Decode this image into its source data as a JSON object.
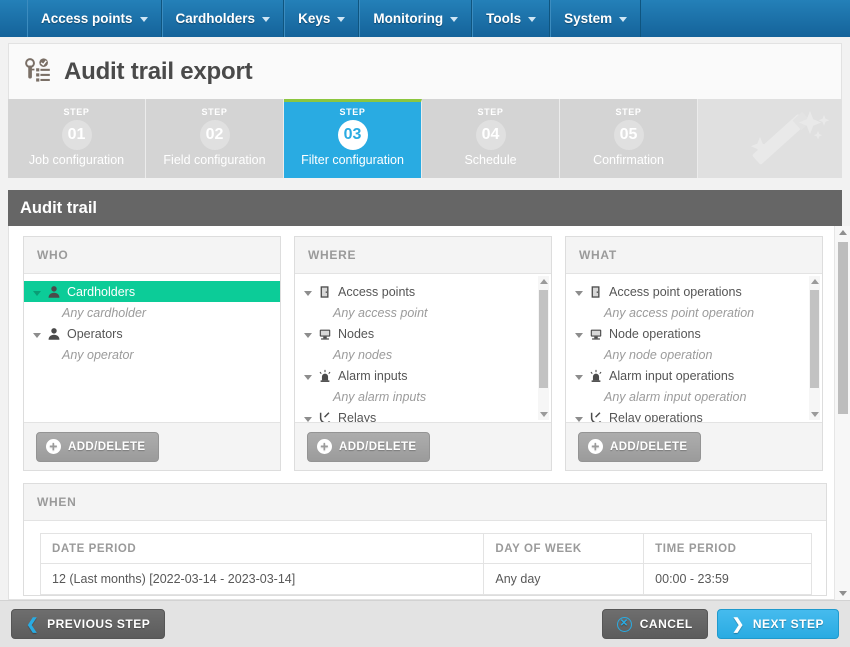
{
  "navbar": {
    "items": [
      {
        "label": "Access points",
        "icon": "chevron-down-icon"
      },
      {
        "label": "Cardholders",
        "icon": "chevron-down-icon"
      },
      {
        "label": "Keys",
        "icon": "chevron-down-icon"
      },
      {
        "label": "Monitoring",
        "icon": "chevron-down-icon"
      },
      {
        "label": "Tools",
        "icon": "chevron-down-icon"
      },
      {
        "label": "System",
        "icon": "chevron-down-icon"
      }
    ]
  },
  "header": {
    "title": "Audit trail export",
    "icon": "key-list-icon"
  },
  "wizard": {
    "step_word": "STEP",
    "watermark_icon": "magic-wand-icon",
    "active_index": 2,
    "active_accent": "#8cc63f",
    "active_bg": "#29abe2",
    "steps": [
      {
        "number": "01",
        "label": "Job configuration"
      },
      {
        "number": "02",
        "label": "Field configuration"
      },
      {
        "number": "03",
        "label": "Filter configuration"
      },
      {
        "number": "04",
        "label": "Schedule"
      },
      {
        "number": "05",
        "label": "Confirmation"
      }
    ]
  },
  "section": {
    "title": "Audit trail"
  },
  "panels": [
    {
      "key": "who",
      "title": "WHO",
      "add_delete_label": "ADD/DELETE",
      "add_icon": "plus-circle-icon",
      "has_scrollbar": false,
      "selected_color": "#0ccc98",
      "nodes": [
        {
          "label": "Cardholders",
          "icon": "person-icon",
          "selected": true,
          "child": "Any cardholder"
        },
        {
          "label": "Operators",
          "icon": "person-icon",
          "selected": false,
          "child": "Any operator"
        }
      ]
    },
    {
      "key": "where",
      "title": "WHERE",
      "add_delete_label": "ADD/DELETE",
      "add_icon": "plus-circle-icon",
      "has_scrollbar": true,
      "nodes": [
        {
          "label": "Access points",
          "icon": "door-icon",
          "selected": false,
          "child": "Any access point"
        },
        {
          "label": "Nodes",
          "icon": "monitor-icon",
          "selected": false,
          "child": "Any nodes"
        },
        {
          "label": "Alarm inputs",
          "icon": "siren-icon",
          "selected": false,
          "child": "Any alarm inputs"
        },
        {
          "label": "Relays",
          "icon": "relay-icon",
          "selected": false,
          "child": ""
        }
      ]
    },
    {
      "key": "what",
      "title": "WHAT",
      "add_delete_label": "ADD/DELETE",
      "add_icon": "plus-circle-icon",
      "has_scrollbar": true,
      "nodes": [
        {
          "label": "Access point operations",
          "icon": "door-icon",
          "selected": false,
          "child": "Any access point operation"
        },
        {
          "label": "Node operations",
          "icon": "monitor-icon",
          "selected": false,
          "child": "Any node operation"
        },
        {
          "label": "Alarm input operations",
          "icon": "siren-icon",
          "selected": false,
          "child": "Any alarm input operation"
        },
        {
          "label": "Relay operations",
          "icon": "relay-icon",
          "selected": false,
          "child": ""
        }
      ]
    }
  ],
  "when": {
    "title": "WHEN",
    "columns": [
      "DATE PERIOD",
      "DAY OF WEEK",
      "TIME PERIOD"
    ],
    "rows": [
      {
        "date_period": "12 (Last months) [2022-03-14 - 2023-03-14]",
        "day_of_week": "Any day",
        "time_period": "00:00 - 23:59"
      }
    ]
  },
  "footer": {
    "previous_label": "PREVIOUS STEP",
    "previous_icon": "chevron-left-icon",
    "cancel_label": "CANCEL",
    "cancel_icon": "x-circle-icon",
    "next_label": "NEXT STEP",
    "next_icon": "chevron-right-icon"
  }
}
